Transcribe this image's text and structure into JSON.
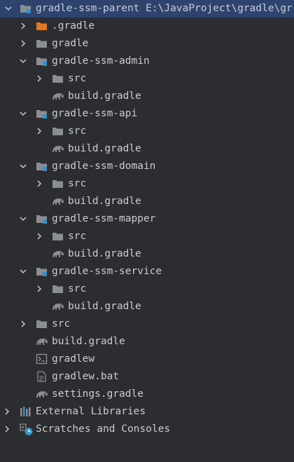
{
  "project_tree": {
    "root": {
      "name": "gradle-ssm-parent",
      "path": "E:\\JavaProject\\gradle\\gr"
    },
    "items": [
      {
        "label": ".gradle"
      },
      {
        "label": "gradle"
      },
      {
        "label": "gradle-ssm-admin"
      },
      {
        "label": "src"
      },
      {
        "label": "build.gradle"
      },
      {
        "label": "gradle-ssm-api"
      },
      {
        "label": "src"
      },
      {
        "label": "build.gradle"
      },
      {
        "label": "gradle-ssm-domain"
      },
      {
        "label": "src"
      },
      {
        "label": "build.gradle"
      },
      {
        "label": "gradle-ssm-mapper"
      },
      {
        "label": "src"
      },
      {
        "label": "build.gradle"
      },
      {
        "label": "gradle-ssm-service"
      },
      {
        "label": "src"
      },
      {
        "label": "build.gradle"
      },
      {
        "label": "src"
      },
      {
        "label": "build.gradle"
      },
      {
        "label": "gradlew"
      },
      {
        "label": "gradlew.bat"
      },
      {
        "label": "settings.gradle"
      },
      {
        "label": "External Libraries"
      },
      {
        "label": "Scratches and Consoles"
      }
    ]
  },
  "colors": {
    "background": "#2B2D30",
    "selection": "#2E436E",
    "text": "#C9CCD1",
    "folder": "#8A8D93",
    "excluded_folder": "#D9782F",
    "module_badge": "#3592C4"
  }
}
